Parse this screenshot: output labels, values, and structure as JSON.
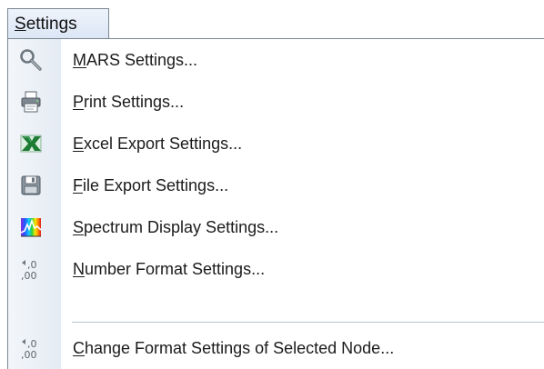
{
  "menu": {
    "title": "Settings",
    "title_mnemonic": "S",
    "items": [
      {
        "id": "mars",
        "mnemonic": "M",
        "label": "MARS Settings...",
        "icon": "wrench-icon"
      },
      {
        "id": "print",
        "mnemonic": "P",
        "label": "Print Settings...",
        "icon": "printer-icon"
      },
      {
        "id": "excel",
        "mnemonic": "E",
        "label": "Excel Export Settings...",
        "icon": "excel-icon"
      },
      {
        "id": "file-export",
        "mnemonic": "F",
        "label": "File Export Settings...",
        "icon": "floppy-disk-icon"
      },
      {
        "id": "spectrum",
        "mnemonic": "S",
        "label": "Spectrum Display Settings...",
        "icon": "spectrum-icon"
      },
      {
        "id": "number-format",
        "mnemonic": "N",
        "label": "Number Format Settings...",
        "icon": "decimal-format-icon"
      },
      {
        "id": "change-format",
        "mnemonic": "C",
        "label": "Change Format Settings of Selected Node...",
        "icon": "decimal-format-icon"
      }
    ]
  },
  "colors": {
    "menu_border": "#7a8794",
    "icon_strip": "#e4ebf3",
    "excel_green": "#1e7b34"
  }
}
